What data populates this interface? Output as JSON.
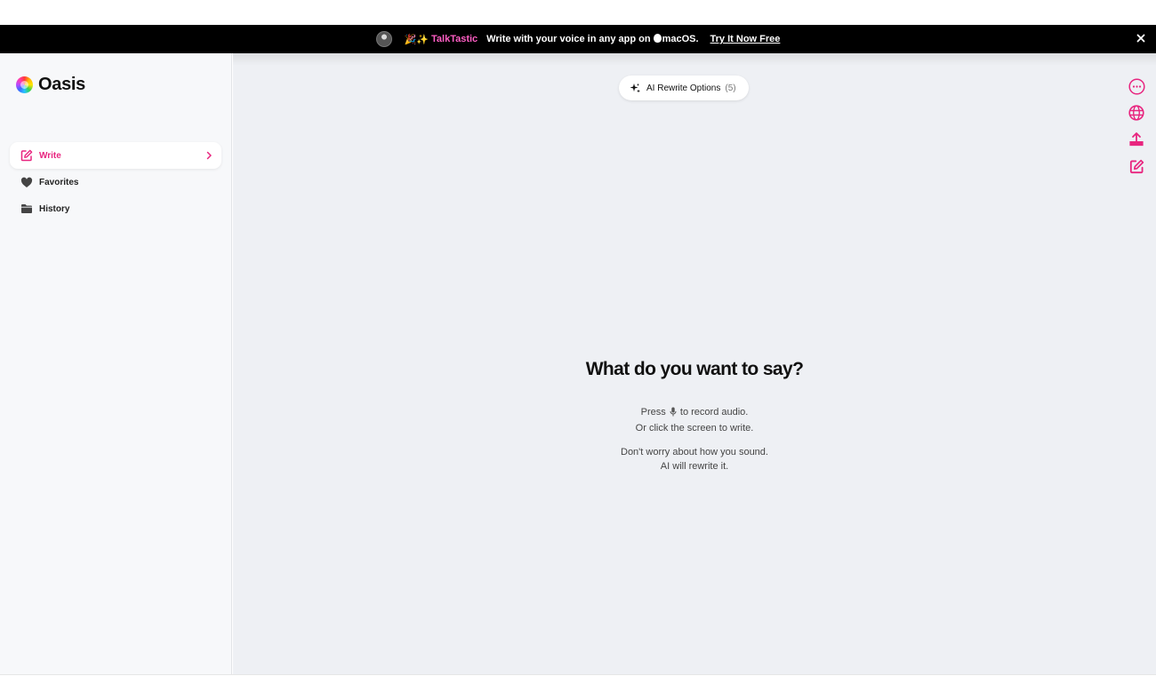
{
  "banner": {
    "emoji": "🎉✨",
    "brand": "TalkTastic",
    "message": "Write with your voice in any app on",
    "platform": "macOS.",
    "cta": "Try It Now Free"
  },
  "app": {
    "name": "Oasis"
  },
  "sidebar": {
    "items": [
      {
        "label": "Write",
        "icon": "edit-icon",
        "active": true
      },
      {
        "label": "Favorites",
        "icon": "heart-icon",
        "active": false
      },
      {
        "label": "History",
        "icon": "folder-icon",
        "active": false
      }
    ]
  },
  "toolbar": {
    "rewrite_label": "AI Rewrite Options",
    "rewrite_count": "(5)"
  },
  "side_tools": [
    "more-icon",
    "globe-icon",
    "upload-icon",
    "new-note-icon"
  ],
  "prompt": {
    "title": "What do you want to say?",
    "line1_pre": "Press",
    "line1_post": "to record audio.",
    "line2": "Or click the screen to write.",
    "line3": "Don't worry about how you sound.",
    "line4": "AI will rewrite it."
  },
  "colors": {
    "accent": "#e8257f",
    "banner_bg": "#000000",
    "brand_pink": "#ff5ec4",
    "sidebar_bg": "#f7f8fa",
    "main_bg": "#eef0f4"
  }
}
